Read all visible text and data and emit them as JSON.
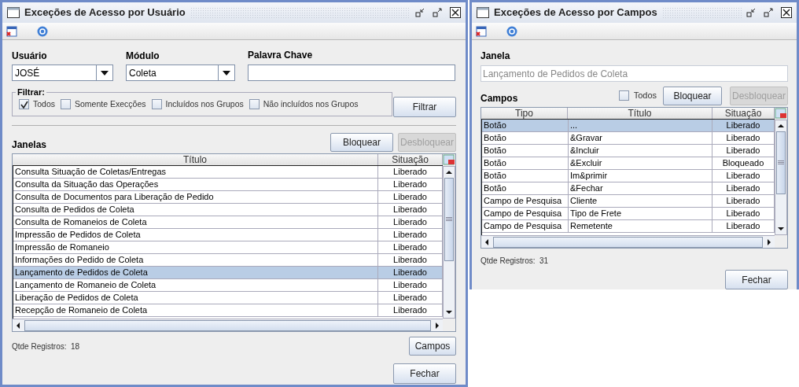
{
  "user_window": {
    "title": "Exceções de Acesso por Usuário",
    "user": {
      "label": "Usuário",
      "value": "JOSÉ"
    },
    "module": {
      "label": "Módulo",
      "value": "Coleta"
    },
    "keyword": {
      "label": "Palavra Chave"
    },
    "filter": {
      "legend": "Filtrar:",
      "options": [
        {
          "label": "Todos",
          "checked": true
        },
        {
          "label": "Somente Execções",
          "checked": false
        },
        {
          "label": "Incluídos nos Grupos",
          "checked": false
        },
        {
          "label": "Não incluídos nos Grupos",
          "checked": false
        }
      ],
      "button": "Filtrar"
    },
    "section": "Janelas",
    "block_button": {
      "label": "Bloquear",
      "disabled": false
    },
    "unblock_button": {
      "label": "Desbloquear",
      "disabled": true
    },
    "columns": [
      "Título",
      "Situação"
    ],
    "rows": [
      {
        "title": "Consulta Situação de Coletas/Entregas",
        "status": "Liberado",
        "selected": false
      },
      {
        "title": "Consulta da Situação das Operações",
        "status": "Liberado",
        "selected": false
      },
      {
        "title": "Consulta de Documentos para Liberação de Pedido",
        "status": "Liberado",
        "selected": false
      },
      {
        "title": "Consulta de Pedidos de Coleta",
        "status": "Liberado",
        "selected": false
      },
      {
        "title": "Consulta de Romaneios de Coleta",
        "status": "Liberado",
        "selected": false
      },
      {
        "title": "Impressão de Pedidos de Coleta",
        "status": "Liberado",
        "selected": false
      },
      {
        "title": "Impressão de Romaneio",
        "status": "Liberado",
        "selected": false
      },
      {
        "title": "Informações do Pedido de Coleta",
        "status": "Liberado",
        "selected": false
      },
      {
        "title": "Lançamento de Pedidos de Coleta",
        "status": "Liberado",
        "selected": true
      },
      {
        "title": "Lançamento de Romaneio de Coleta",
        "status": "Liberado",
        "selected": false
      },
      {
        "title": "Liberação de Pedidos de Coleta",
        "status": "Liberado",
        "selected": false
      },
      {
        "title": "Recepção de Romaneio de Coleta",
        "status": "Liberado",
        "selected": false
      }
    ],
    "count": "Qtde Registros:  18",
    "fields_button": "Campos",
    "close_button": "Fechar"
  },
  "fields_window": {
    "title": "Exceções de Acesso por Campos",
    "window_field": {
      "label": "Janela",
      "value": "Lançamento de Pedidos de Coleta",
      "disabled": true
    },
    "section": "Campos",
    "all": {
      "label": "Todos",
      "checked": false
    },
    "block_button": {
      "label": "Bloquear",
      "disabled": false
    },
    "unblock_button": {
      "label": "Desbloquear",
      "disabled": true
    },
    "columns": [
      "Tipo",
      "Título",
      "Situação"
    ],
    "rows": [
      {
        "type": "Botão",
        "title": "...",
        "status": "Liberado",
        "selected": true
      },
      {
        "type": "Botão",
        "title": "&Gravar",
        "status": "Liberado",
        "selected": false
      },
      {
        "type": "Botão",
        "title": "&Incluir",
        "status": "Liberado",
        "selected": false
      },
      {
        "type": "Botão",
        "title": "&Excluir",
        "status": "Bloqueado",
        "selected": false
      },
      {
        "type": "Botão",
        "title": "Im&primir",
        "status": "Liberado",
        "selected": false
      },
      {
        "type": "Botão",
        "title": "&Fechar",
        "status": "Liberado",
        "selected": false
      },
      {
        "type": "Campo de Pesquisa",
        "title": "Cliente",
        "status": "Liberado",
        "selected": false
      },
      {
        "type": "Campo de Pesquisa",
        "title": "Tipo de Frete",
        "status": "Liberado",
        "selected": false
      },
      {
        "type": "Campo de Pesquisa",
        "title": "Remetente",
        "status": "Liberado",
        "selected": false
      }
    ],
    "count": "Qtde Registros:  31",
    "close_button": "Fechar"
  }
}
